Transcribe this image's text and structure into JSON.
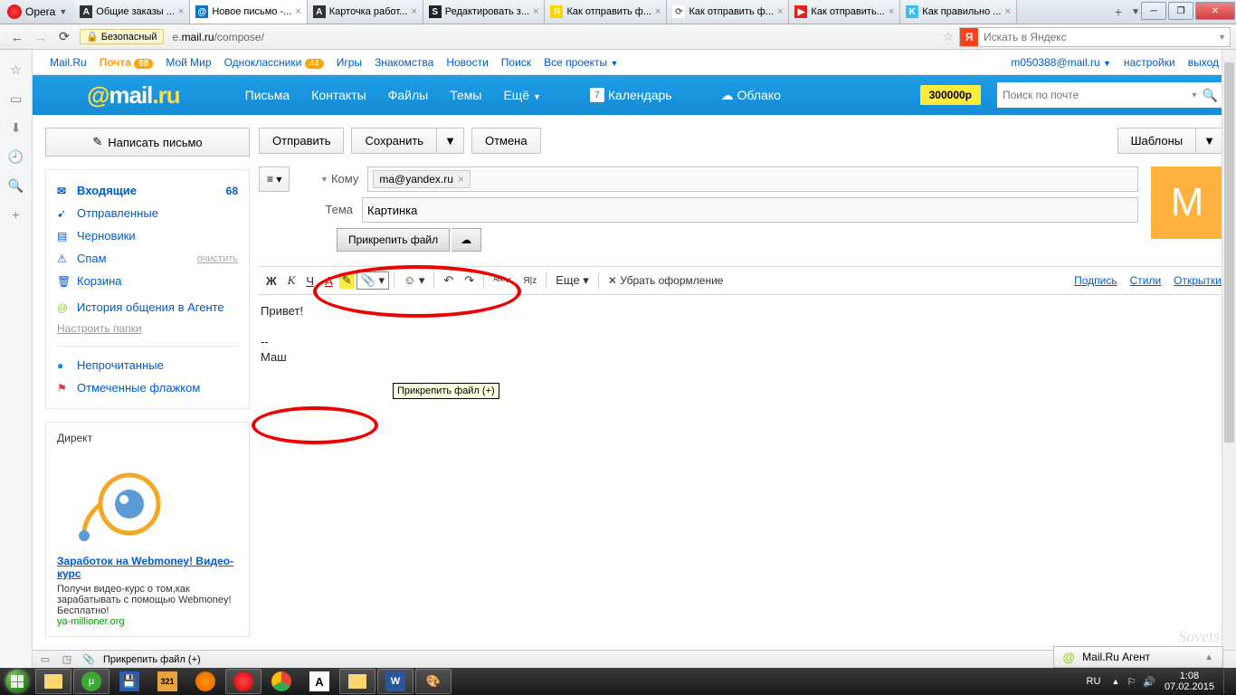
{
  "window": {
    "opera_label": "Opera",
    "tabs": [
      {
        "icon_bg": "#333",
        "icon_txt": "A",
        "label": "Общие заказы ...",
        "active": false
      },
      {
        "icon_bg": "#0b76c4",
        "icon_txt": "@",
        "label": "Новое письмо -...",
        "active": true
      },
      {
        "icon_bg": "#333",
        "icon_txt": "A",
        "label": "Карточка работ...",
        "active": false
      },
      {
        "icon_bg": "#222",
        "icon_txt": "S",
        "label": "Редактировать з...",
        "active": false
      },
      {
        "icon_bg": "#ffd400",
        "icon_txt": "Я",
        "label": "Как отправить ф...",
        "active": false
      },
      {
        "icon_bg": "#fff",
        "icon_txt": "⟳",
        "label": "Как отправить ф...",
        "active": false
      },
      {
        "icon_bg": "#e62117",
        "icon_txt": "▶",
        "label": "Как отправить...",
        "active": false
      },
      {
        "icon_bg": "#3ac0f0",
        "icon_txt": "K",
        "label": "Как правильно ...",
        "active": false
      }
    ],
    "security": "Безопасный",
    "url_prefix": "e.",
    "url_domain": "mail.ru",
    "url_path": "/compose/",
    "yandex_placeholder": "Искать в Яндекс"
  },
  "topbar": {
    "links": [
      "Mail.Ru",
      "Почта",
      "Мой Мир",
      "Одноклассники",
      "Игры",
      "Знакомства",
      "Новости",
      "Поиск",
      "Все проекты"
    ],
    "pochta_badge": "68",
    "ok_badge": "44",
    "email": "m050388@mail.ru",
    "settings": "настройки",
    "exit": "выход"
  },
  "header": {
    "nav": [
      "Письма",
      "Контакты",
      "Файлы",
      "Темы",
      "Ещё"
    ],
    "calendar_day": "7",
    "calendar": "Календарь",
    "cloud": "Облако",
    "promo": "300000р",
    "search_placeholder": "Поиск по почте"
  },
  "sidebar": {
    "compose": "Написать письмо",
    "folders": {
      "inbox": "Входящие",
      "inbox_count": "68",
      "sent": "Отправленные",
      "drafts": "Черновики",
      "spam": "Спам",
      "spam_clear": "очистить",
      "trash": "Корзина",
      "agent": "История общения в Агенте",
      "configure": "Настроить папки",
      "unread": "Непрочитанные",
      "flagged": "Отмеченные флажком"
    },
    "ad": {
      "title": "Директ",
      "link": "Заработок на Webmoney! Видео-курс",
      "text": "Получи видео-курс о том,как зарабатывать с помощью Webmoney! Бесплатно!",
      "src": "ya-millioner.org"
    }
  },
  "compose": {
    "send": "Отправить",
    "save": "Сохранить",
    "cancel": "Отмена",
    "templates": "Шаблоны",
    "to_label": "Кому",
    "to_chip": "ma@yandex.ru",
    "subject_label": "Тема",
    "subject_value": "Картинка",
    "attach": "Прикрепить файл",
    "avatar_letter": "M",
    "tooltip": "Прикрепить файл (+)",
    "more": "Еще",
    "remove_fmt": "Убрать оформление",
    "links": {
      "sign": "Подпись",
      "styles": "Стили",
      "cards": "Открытки"
    },
    "body_greet": "Привет!",
    "body_sep": "--",
    "body_sign": "Маш"
  },
  "statusbar": {
    "attach": "Прикрепить файл (+)"
  },
  "agent_bar": "Mail.Ru Агент",
  "tray": {
    "lang": "RU",
    "time": "1:08",
    "date": "07.02.2015"
  },
  "watermark": "Sovets"
}
